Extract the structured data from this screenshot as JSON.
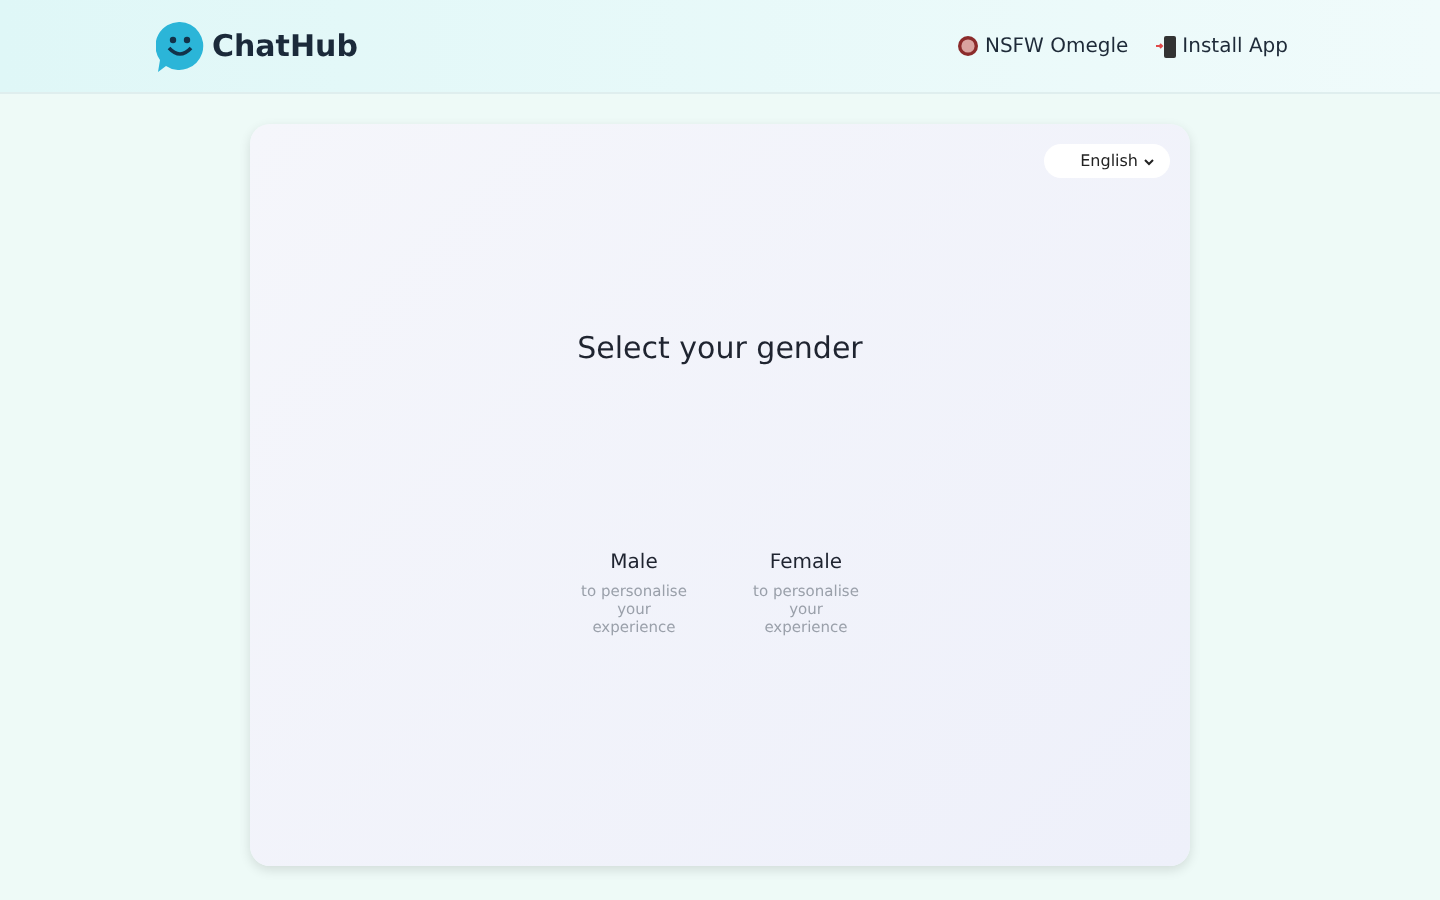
{
  "header": {
    "logo": "ChatHub",
    "links": [
      {
        "kind": "nsfw",
        "label": "NSFW Omegle"
      },
      {
        "kind": "install",
        "label": "Install App"
      }
    ]
  },
  "card": {
    "language": "English",
    "title": "Select your gender",
    "options": [
      {
        "label": "Male",
        "subtitle": "to personalise your experience"
      },
      {
        "label": "Female",
        "subtitle": "to personalise your experience"
      }
    ]
  }
}
